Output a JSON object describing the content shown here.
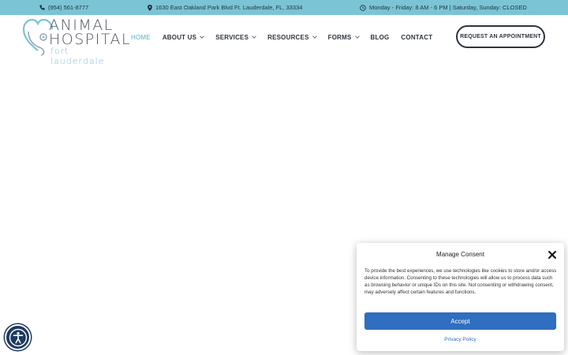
{
  "topbar": {
    "phone": "(954) 561-8777",
    "address": "1630 East Oakland Park Blvd Ft. Lauderdale, FL, 33334",
    "hours": "Monday - Friday: 8 AM - 6 PM | Saturday, Sunday: CLOSED"
  },
  "logo": {
    "line1": "ANIMAL",
    "line2": "HOSPITAL",
    "line3": "fort lauderdale"
  },
  "nav": {
    "items": [
      {
        "label": "HOME"
      },
      {
        "label": "ABOUT US"
      },
      {
        "label": "SERVICES"
      },
      {
        "label": "RESOURCES"
      },
      {
        "label": "FORMS"
      },
      {
        "label": "BLOG"
      },
      {
        "label": "CONTACT"
      }
    ]
  },
  "cta": {
    "label": "REQUEST AN APPOINTMENT"
  },
  "consent": {
    "title": "Manage Consent",
    "body": "To provide the best experiences, we use technologies like cookies to store and/or access device information. Consenting to these technologies will allow us to process data such as browsing behavior or unique IDs on this site. Not consenting or withdrawing consent, may adversely affect certain features and functions.",
    "accept_label": "Accept",
    "policy_label": "Privacy Policy"
  },
  "colors": {
    "topbar": "#7ac4d5",
    "accent": "#5aaec4",
    "accept": "#2f6ec0",
    "accessibility": "#1e3a5f"
  },
  "icons": [
    "phone-icon",
    "map-pin-icon",
    "clock-icon",
    "close-icon",
    "accessibility-icon",
    "chevron-down-icon"
  ]
}
